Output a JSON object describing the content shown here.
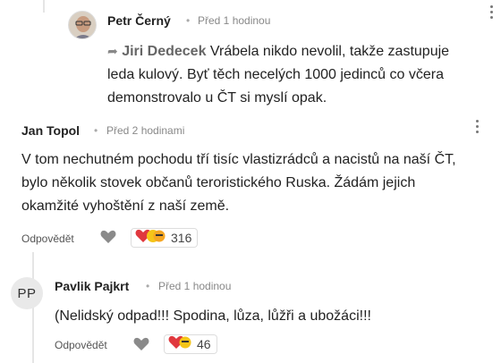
{
  "comments": [
    {
      "author": "Petr Černý",
      "time": "Před 1 hodinou",
      "reply_to": "Jiri Dedecek",
      "text_line1": "Vrábela nikdo nevolil, takže zastupuje",
      "text_line2": "leda kulový. Byť těch necelých 1000 jedinců co včera",
      "text_line3": "demonstrovalo u ČT si myslí opak."
    },
    {
      "author": "Jan Topol",
      "time": "Před 2 hodinami",
      "text_line1": "V tom nechutném pochodu tří tisíc vlastizrádců a nacistů na naší ČT,",
      "text_line2": "bylo několik stovek občanů teroristického Ruska. Žádám jejich",
      "text_line3": "okamžité vyhoštění z naší země.",
      "reply_label": "Odpovědět",
      "reaction_count": "316"
    },
    {
      "author": "Pavlik Pajkrt",
      "avatar_initials": "PP",
      "time": "Před 1 hodinou",
      "text_line1": "(Nelidský odpad!!! Spodina, lůza, lůžři a ubožáci!!!",
      "reply_label": "Odpovědět",
      "reaction_count": "46"
    }
  ],
  "separator": "•",
  "colors": {
    "heart": "#8a8a8a",
    "reaction_red": "#e0383e",
    "reaction_yellow": "#f5c518"
  },
  "icons": [
    "reply-arrow-icon",
    "heart-icon",
    "reactions-icon",
    "more-options-icon"
  ]
}
